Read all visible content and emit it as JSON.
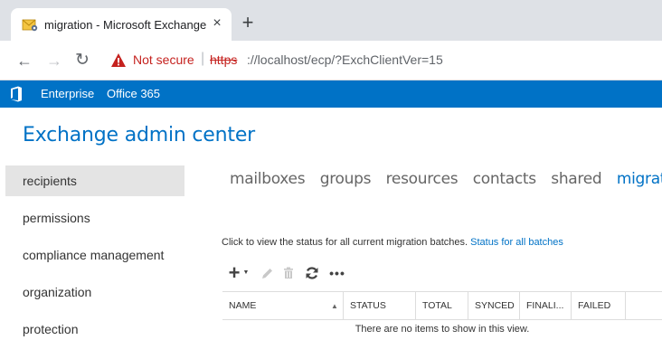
{
  "browser": {
    "tab_title": "migration - Microsoft Exchange",
    "tab_close": "×",
    "new_tab": "+",
    "nav": {
      "back": "←",
      "forward": "→",
      "reload": "↻"
    },
    "security_label": "Not secure",
    "separator": "|",
    "url_scheme": "https",
    "url_rest": "://localhost/ecp/?ExchClientVer=15"
  },
  "o365": {
    "items": [
      "Enterprise",
      "Office 365"
    ]
  },
  "page_title": "Exchange admin center",
  "sidebar": {
    "items": [
      {
        "label": "recipients",
        "active": true
      },
      {
        "label": "permissions",
        "active": false
      },
      {
        "label": "compliance management",
        "active": false
      },
      {
        "label": "organization",
        "active": false
      },
      {
        "label": "protection",
        "active": false
      }
    ]
  },
  "tabs": {
    "items": [
      "mailboxes",
      "groups",
      "resources",
      "contacts",
      "shared",
      "migration"
    ],
    "selected": "migration"
  },
  "info": {
    "text": "Click to view the status for all current migration batches. ",
    "link": "Status for all batches"
  },
  "actions": {
    "add": "+",
    "caret": "▼",
    "more": "•••"
  },
  "grid": {
    "columns": [
      "NAME",
      "STATUS",
      "TOTAL",
      "SYNCED",
      "FINALI...",
      "FAILED"
    ],
    "sort_indicator": "▲",
    "empty_message": "There are no items to show in this view."
  },
  "colors": {
    "accent": "#0072c6",
    "warning": "#c5221f",
    "sidebar_active": "#e4e4e4"
  }
}
